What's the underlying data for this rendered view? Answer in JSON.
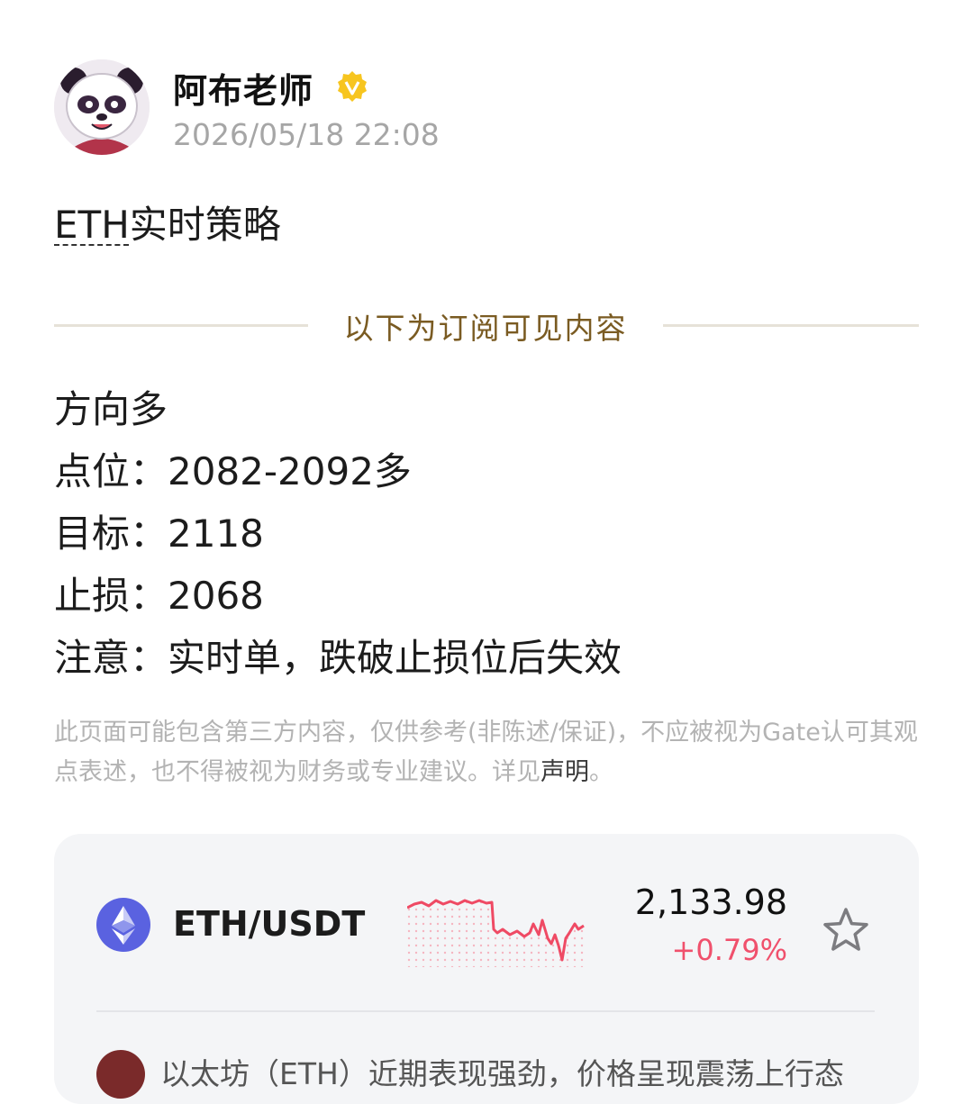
{
  "author": {
    "name": "阿布老师",
    "timestamp": "2026/05/18 22:08",
    "verified_icon": "verified-badge-icon"
  },
  "post": {
    "title_ticker": "ETH",
    "title_rest": "实时策略"
  },
  "subscription_divider": "以下为订阅可见内容",
  "content_lines": [
    "方向多",
    "点位：2082-2092多",
    "目标：2118",
    "止损：2068",
    "注意：实时单，跌破止损位后失效"
  ],
  "disclaimer": {
    "text": "此页面可能包含第三方内容，仅供参考(非陈述/保证)，不应被视为Gate认可其观点表述，也不得被视为财务或专业建议。详见",
    "link": "声明",
    "end": "。"
  },
  "ticker_card": {
    "pair": "ETH/USDT",
    "price": "2,133.98",
    "change": "+0.79%",
    "change_color": "#f0506c",
    "icon": "ethereum-icon",
    "star_icon": "star-outline-icon",
    "news_snippet": "以太坊（ETH）近期表现强劲，价格呈现震荡上行态"
  }
}
